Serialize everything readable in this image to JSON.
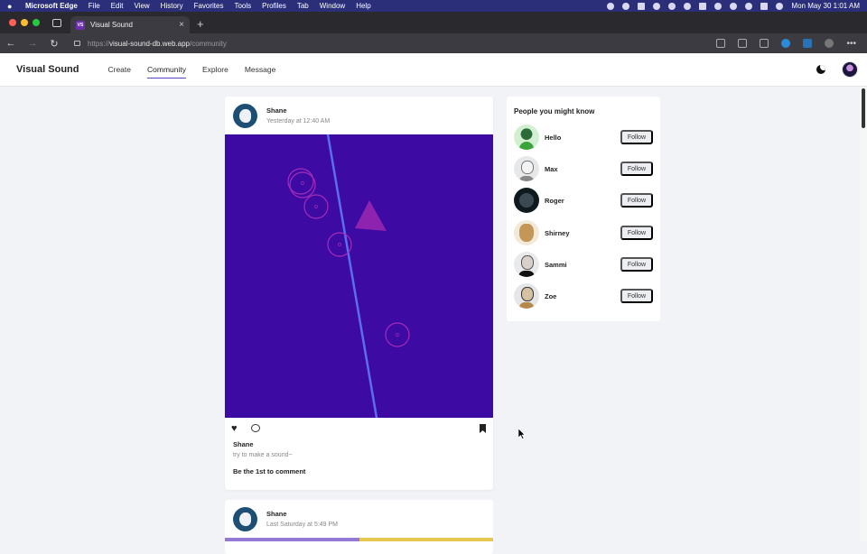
{
  "menubar": {
    "app_name": "Microsoft Edge",
    "items": [
      "File",
      "Edit",
      "View",
      "History",
      "Favorites",
      "Tools",
      "Profiles",
      "Tab",
      "Window",
      "Help"
    ],
    "clock": "Mon May 30  1:01 AM"
  },
  "browser": {
    "tab_title": "Visual Sound",
    "tab_favicon_text": "VS",
    "url_scheme": "https://",
    "url_host": "visual-sound-db.web.app",
    "url_path": "/community"
  },
  "app": {
    "brand": "Visual Sound",
    "nav": [
      "Create",
      "Community",
      "Explore",
      "Message"
    ],
    "active_nav": "Community",
    "accent_color": "#5a44c4"
  },
  "post": {
    "author": "Shane",
    "time": "Yesterday at 12:40 AM",
    "art_background": "#3e0aa4",
    "caption_name": "Shane",
    "caption_text": "try to make a sound~",
    "first_comment": "Be the 1st to comment"
  },
  "post2": {
    "author": "Shane",
    "time": "Last Saturday at 5:49 PM"
  },
  "suggestions": {
    "title": "People you might know",
    "follow_label": "Follow",
    "people": [
      "Hello",
      "Max",
      "Roger",
      "Shirney",
      "Sammi",
      "Zoe"
    ]
  }
}
